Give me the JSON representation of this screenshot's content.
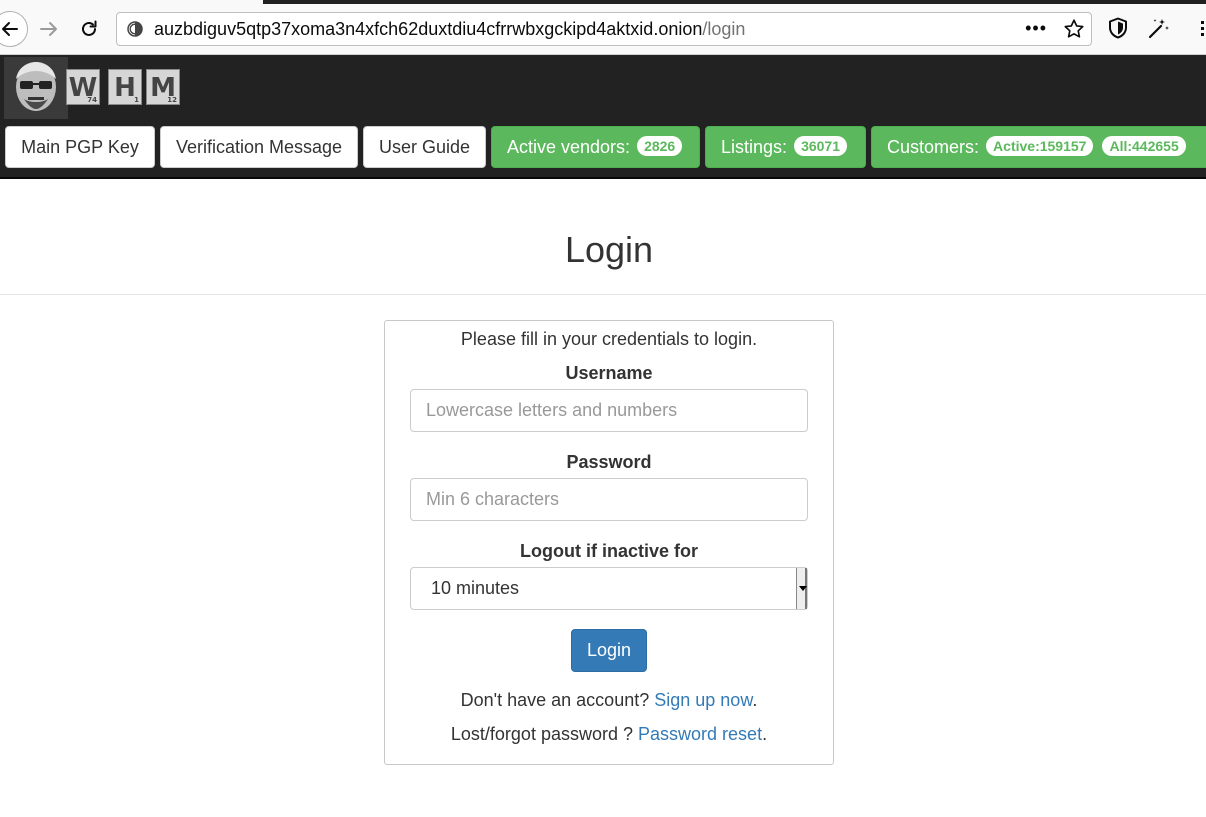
{
  "browser": {
    "url_host": "auzbdiguv5qtp37xoma3n4xfch62duxtdiu4cfrrwbxgckipd4aktxid.onion",
    "url_path": "/login",
    "url_more": "•••"
  },
  "header": {
    "logo_letters": [
      "W",
      "H",
      "M"
    ],
    "logo_subscripts": [
      "74",
      "1",
      "12"
    ],
    "nav": {
      "main_pgp_key": "Main PGP Key",
      "verification_message": "Verification Message",
      "user_guide": "User Guide"
    },
    "stats": {
      "active_vendors_label": "Active vendors:",
      "active_vendors_count": "2826",
      "listings_label": "Listings:",
      "listings_count": "36071",
      "customers_label": "Customers:",
      "customers_active": "Active:159157",
      "customers_all": "All:442655"
    }
  },
  "login": {
    "title": "Login",
    "intro": "Please fill in your credentials to login.",
    "username_label": "Username",
    "username_placeholder": "Lowercase letters and numbers",
    "password_label": "Password",
    "password_placeholder": "Min 6 characters",
    "logout_label": "Logout if inactive for",
    "logout_selected": "10 minutes",
    "submit_label": "Login",
    "signup_prefix": "Don't have an account?",
    "signup_link": "Sign up now",
    "signup_suffix": ".",
    "reset_prefix": "Lost/forgot password ?",
    "reset_link": "Password reset",
    "reset_suffix": "."
  },
  "colors": {
    "header_bg": "#222222",
    "stat_green": "#5cb85c",
    "primary_blue": "#337ab7"
  }
}
